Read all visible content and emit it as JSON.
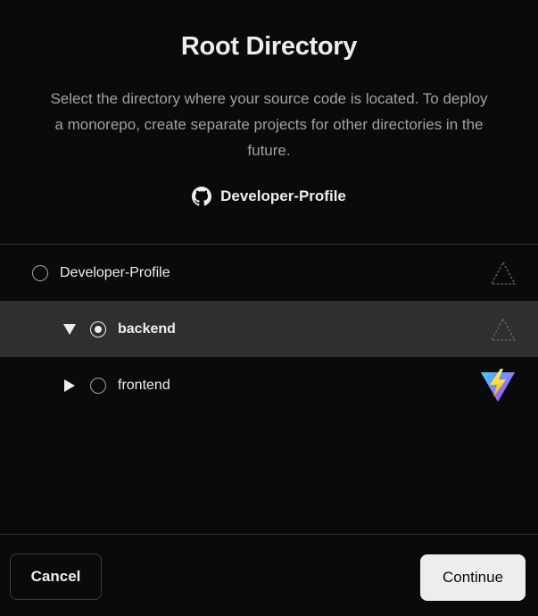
{
  "modal": {
    "title": "Root Directory",
    "description": "Select the directory where your source code is located. To deploy a monorepo, create separate projects for other directories in the future.",
    "repo_icon": "github-icon",
    "repo_name": "Developer-Profile"
  },
  "tree": {
    "items": [
      {
        "label": "Developer-Profile",
        "selected": false,
        "expandable": false,
        "framework_icon": "vercel-triangle-dashed-icon"
      },
      {
        "label": "backend",
        "selected": true,
        "expandable": true,
        "expanded": true,
        "framework_icon": "vercel-triangle-dashed-icon"
      },
      {
        "label": "frontend",
        "selected": false,
        "expandable": true,
        "expanded": false,
        "framework_icon": "vite-icon"
      }
    ]
  },
  "footer": {
    "cancel_label": "Cancel",
    "continue_label": "Continue"
  },
  "colors": {
    "background": "#0a0a0a",
    "selected_row": "#2f2f2f",
    "text_primary": "#ededed",
    "text_secondary": "#a1a1a1",
    "divider": "#2e2e2e",
    "primary_button_bg": "#ededed",
    "vite_purple": "#8a6cff",
    "vite_yellow": "#ffd62e"
  }
}
